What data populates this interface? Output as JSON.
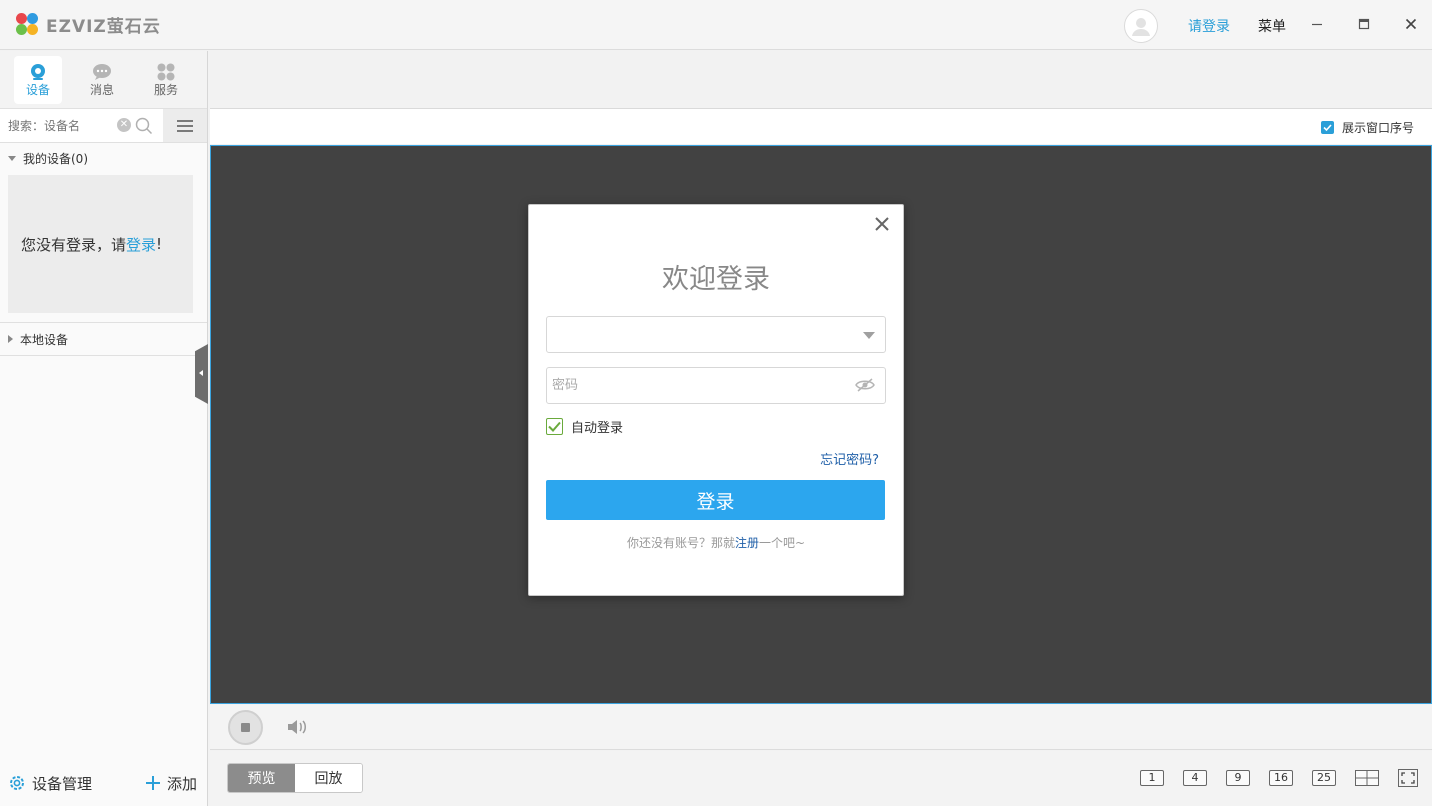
{
  "app": {
    "logo_text": "EZVIZ萤石云",
    "login_link": "请登录",
    "menu_label": "菜单"
  },
  "sidebar": {
    "tabs": [
      {
        "label": "设备",
        "icon": "camera-icon",
        "active": true
      },
      {
        "label": "消息",
        "icon": "message-icon",
        "active": false
      },
      {
        "label": "服务",
        "icon": "services-icon",
        "active": false
      }
    ],
    "search_placeholder": "搜索：设备名",
    "my_devices": "我的设备(0)",
    "notice_prefix": "您没有登录，请",
    "notice_link": "登录",
    "notice_suffix": "!",
    "local_devices": "本地设备",
    "footer_manage": "设备管理",
    "footer_add": "添加"
  },
  "view": {
    "show_window_index": "展示窗口序号",
    "show_window_index_checked": true,
    "mode_preview": "预览",
    "mode_playback": "回放",
    "grid_options": [
      "1",
      "4",
      "9",
      "16",
      "25"
    ]
  },
  "login_dialog": {
    "title": "欢迎登录",
    "username_value": "",
    "password_placeholder": "密码",
    "auto_login": "自动登录",
    "auto_login_checked": true,
    "forgot": "忘记密码?",
    "submit": "登录",
    "register_prefix": "你还没有账号？那就",
    "register_link": "注册",
    "register_suffix": "一个吧~"
  },
  "colors": {
    "accent": "#2a9fd8",
    "button": "#2ca6ee",
    "video_bg": "#424242",
    "link_dark": "#1f5fa8"
  }
}
